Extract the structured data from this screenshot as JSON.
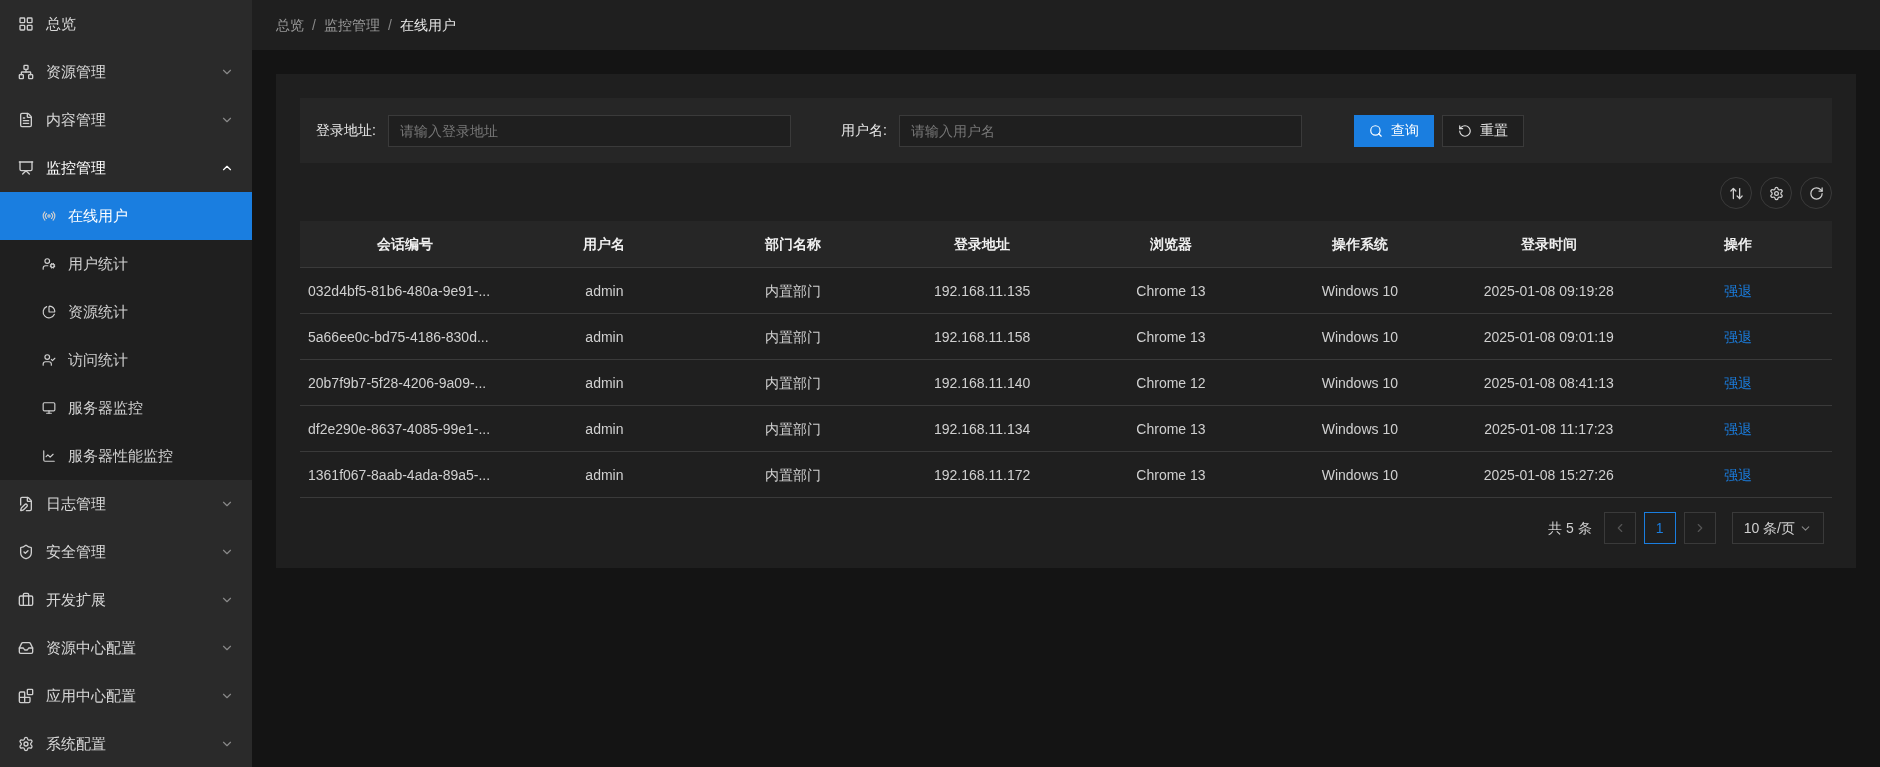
{
  "sidebar": {
    "items": [
      {
        "label": "总览",
        "kind": "link",
        "expanded": false
      },
      {
        "label": "资源管理",
        "kind": "group",
        "expanded": false
      },
      {
        "label": "内容管理",
        "kind": "group",
        "expanded": false
      },
      {
        "label": "监控管理",
        "kind": "group",
        "expanded": true,
        "children": [
          {
            "label": "在线用户",
            "selected": true
          },
          {
            "label": "用户统计",
            "selected": false
          },
          {
            "label": "资源统计",
            "selected": false
          },
          {
            "label": "访问统计",
            "selected": false
          },
          {
            "label": "服务器监控",
            "selected": false
          },
          {
            "label": "服务器性能监控",
            "selected": false
          }
        ]
      },
      {
        "label": "日志管理",
        "kind": "group",
        "expanded": false
      },
      {
        "label": "安全管理",
        "kind": "group",
        "expanded": false
      },
      {
        "label": "开发扩展",
        "kind": "group",
        "expanded": false
      },
      {
        "label": "资源中心配置",
        "kind": "group",
        "expanded": false
      },
      {
        "label": "应用中心配置",
        "kind": "group",
        "expanded": false
      },
      {
        "label": "系统配置",
        "kind": "group",
        "expanded": false
      }
    ]
  },
  "breadcrumb": [
    {
      "label": "总览"
    },
    {
      "label": "监控管理"
    },
    {
      "label": "在线用户"
    }
  ],
  "breadcrumb_separator": "/",
  "search": {
    "fields": [
      {
        "label": "登录地址:",
        "placeholder": "请输入登录地址"
      },
      {
        "label": "用户名:",
        "placeholder": "请输入用户名"
      }
    ],
    "buttons": [
      {
        "label": "查询",
        "kind": "primary"
      },
      {
        "label": "重置",
        "kind": "reset"
      }
    ]
  },
  "toolbar": [
    {
      "kind": "density"
    },
    {
      "kind": "settings"
    },
    {
      "kind": "refresh"
    }
  ],
  "table": {
    "columns": [
      "会话编号",
      "用户名",
      "部门名称",
      "登录地址",
      "浏览器",
      "操作系统",
      "登录时间",
      "操作"
    ],
    "rows": [
      [
        "032d4bf5-81b6-480a-9e91-...",
        "admin",
        "内置部门",
        "192.168.11.135",
        "Chrome 13",
        "Windows 10",
        "2025-01-08 09:19:28",
        "强退"
      ],
      [
        "5a66ee0c-bd75-4186-830d...",
        "admin",
        "内置部门",
        "192.168.11.158",
        "Chrome 13",
        "Windows 10",
        "2025-01-08 09:01:19",
        "强退"
      ],
      [
        "20b7f9b7-5f28-4206-9a09-...",
        "admin",
        "内置部门",
        "192.168.11.140",
        "Chrome 12",
        "Windows 10",
        "2025-01-08 08:41:13",
        "强退"
      ],
      [
        "df2e290e-8637-4085-99e1-...",
        "admin",
        "内置部门",
        "192.168.11.134",
        "Chrome 13",
        "Windows 10",
        "2025-01-08 11:17:23",
        "强退"
      ],
      [
        "1361f067-8aab-4ada-89a5-...",
        "admin",
        "内置部门",
        "192.168.11.172",
        "Chrome 13",
        "Windows 10",
        "2025-01-08 15:27:26",
        "强退"
      ]
    ]
  },
  "pagination": {
    "total": "共 5 条",
    "prev": {
      "disabled": true
    },
    "pages": [
      {
        "label": "1",
        "selected": true
      }
    ],
    "next": {
      "disabled": true
    },
    "page_size": "10 条/页"
  }
}
